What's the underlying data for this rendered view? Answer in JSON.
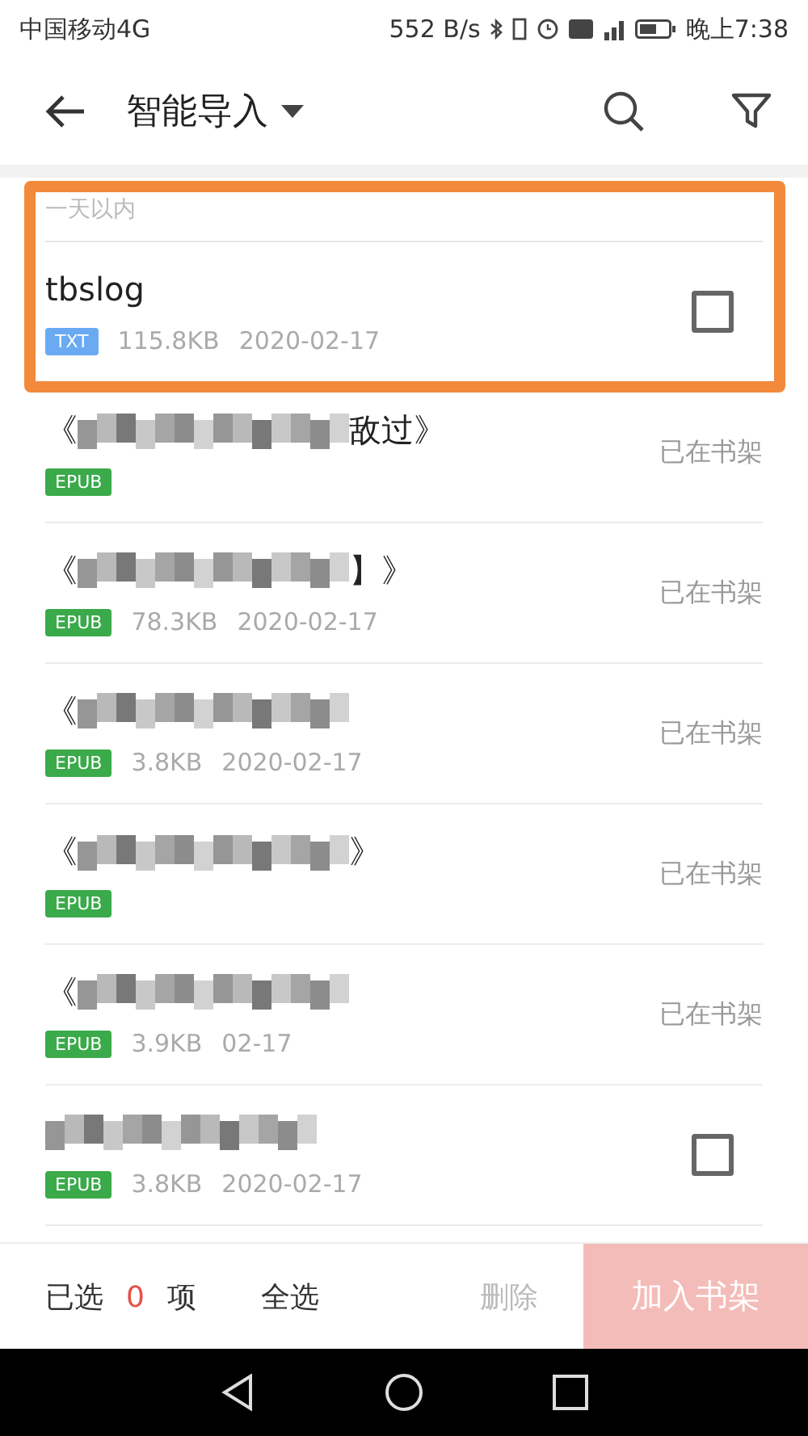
{
  "status_bar": {
    "carrier": "中国移动4G",
    "speed": "552 B/s",
    "time": "晚上7:38"
  },
  "toolbar": {
    "title": "智能导入"
  },
  "section": {
    "label": "一天以内",
    "highlighted": true
  },
  "files": [
    {
      "kind": "selectable",
      "title_start": "tbslog",
      "blurred": false,
      "format": "TXT",
      "size": "115.8KB",
      "date": "2020-02-17",
      "checked": false
    },
    {
      "kind": "on_shelf",
      "title_start": "《",
      "title_end": "敌过》",
      "blurred": true,
      "format": "EPUB",
      "shelf_label": "已在书架"
    },
    {
      "kind": "on_shelf",
      "title_start": "《",
      "title_end": "】》",
      "blurred": true,
      "format": "EPUB",
      "size": "78.3KB",
      "date": "2020-02-17",
      "shelf_label": "已在书架"
    },
    {
      "kind": "on_shelf",
      "title_start": "《",
      "blurred": true,
      "format": "EPUB",
      "size": "3.8KB",
      "date": "2020-02-17",
      "shelf_label": "已在书架"
    },
    {
      "kind": "on_shelf",
      "title_start": "《",
      "title_end": "》",
      "blurred": true,
      "format": "EPUB",
      "shelf_label": "已在书架"
    },
    {
      "kind": "on_shelf",
      "title_start": "《",
      "blurred": true,
      "format": "EPUB",
      "size": "3.9KB",
      "date": "02-17",
      "shelf_label": "已在书架"
    },
    {
      "kind": "selectable",
      "blurred": true,
      "format": "EPUB",
      "size": "3.8KB",
      "date": "2020-02-17",
      "checked": false
    }
  ],
  "footer": {
    "selected_prefix": "已选",
    "selected_count": "0",
    "selected_suffix": "项",
    "select_all": "全选",
    "delete": "删除",
    "add_to_shelf": "加入书架",
    "add_enabled": false
  }
}
